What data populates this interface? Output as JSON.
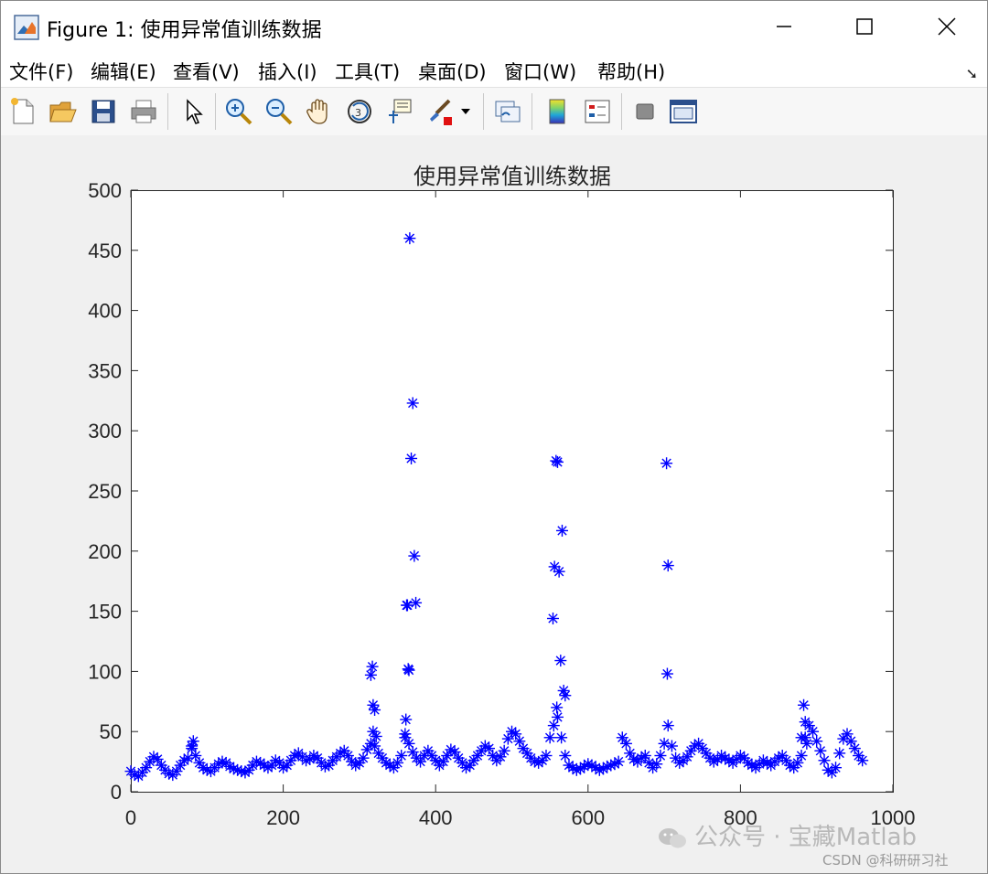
{
  "window": {
    "title": "Figure 1: 使用异常值训练数据",
    "icon": "matlab-figure-icon"
  },
  "menu": {
    "items": [
      "文件(F)",
      "编辑(E)",
      "查看(V)",
      "插入(I)",
      "工具(T)",
      "桌面(D)",
      "窗口(W)",
      "帮助(H)"
    ]
  },
  "toolbar": {
    "icons": [
      "new-figure-icon",
      "open-file-icon",
      "save-icon",
      "print-icon",
      "pointer-icon",
      "zoom-in-icon",
      "zoom-out-icon",
      "pan-hand-icon",
      "rotate-3d-icon",
      "data-cursor-icon",
      "brush-icon",
      "link-plot-icon",
      "colorbar-icon",
      "legend-icon",
      "hide-tools-icon",
      "dock-icon"
    ]
  },
  "watermark": {
    "line1": "公众号 · 宝藏Matlab",
    "line2": "CSDN @科研研习社"
  },
  "colors": {
    "marker": "#0000ff",
    "axes": "#262626",
    "figure_bg": "#f0f0f0"
  },
  "chart_data": {
    "type": "scatter",
    "title": "使用异常值训练数据",
    "marker": "*",
    "xlim": [
      0,
      1000
    ],
    "ylim": [
      0,
      500
    ],
    "xticks": [
      0,
      200,
      400,
      600,
      800,
      1000
    ],
    "yticks": [
      0,
      50,
      100,
      150,
      200,
      250,
      300,
      350,
      400,
      450,
      500
    ],
    "grid": false,
    "series": [
      {
        "x": [
          0,
          5,
          10,
          15,
          20,
          25,
          30,
          35,
          40,
          45,
          50,
          55,
          60,
          65,
          70,
          75,
          80,
          85,
          90,
          95,
          100,
          105,
          110,
          115,
          120,
          125,
          130,
          135,
          140,
          145,
          150,
          155,
          160,
          165,
          170,
          175,
          180,
          185,
          190,
          195,
          200,
          205,
          210,
          215,
          220,
          225,
          230,
          235,
          240,
          245,
          250,
          255,
          260,
          265,
          270,
          275,
          280,
          285,
          290,
          295,
          300,
          305,
          310,
          315,
          320,
          325,
          330,
          335,
          340,
          345,
          350,
          355,
          360,
          365,
          370,
          375,
          380,
          385,
          390,
          395,
          400,
          405,
          410,
          415,
          420,
          425,
          430,
          435,
          440,
          445,
          450,
          455,
          460,
          465,
          470,
          475,
          480,
          485,
          490,
          495,
          500,
          505,
          510,
          515,
          520,
          525,
          530,
          535,
          540,
          545,
          550,
          555,
          560,
          565,
          570,
          575,
          580,
          585,
          590,
          595,
          600,
          605,
          610,
          615,
          620,
          625,
          630,
          635,
          640,
          645,
          650,
          655,
          660,
          665,
          670,
          675,
          680,
          685,
          690,
          695,
          700,
          705,
          710,
          715,
          720,
          725,
          730,
          735,
          740,
          745,
          750,
          755,
          760,
          765,
          770,
          775,
          780,
          785,
          790,
          795,
          800,
          805,
          810,
          815,
          820,
          825,
          830,
          835,
          840,
          845,
          850,
          855,
          860,
          865,
          870,
          875,
          880,
          885,
          890,
          895,
          900,
          905,
          910,
          915,
          920,
          925,
          930,
          935,
          940,
          945,
          950,
          955,
          960,
          315,
          317,
          318,
          320,
          362,
          364,
          366,
          368,
          370,
          372,
          374,
          363,
          365,
          361,
          554,
          556,
          558,
          560,
          562,
          564,
          566,
          568,
          570,
          559,
          703,
          705,
          704,
          883,
          885,
          880,
          887,
          82,
          80,
          318,
          322,
          360
        ],
        "y": [
          17,
          14,
          13,
          16,
          20,
          25,
          29,
          27,
          22,
          18,
          15,
          14,
          17,
          22,
          26,
          28,
          36,
          30,
          24,
          20,
          18,
          17,
          20,
          23,
          25,
          24,
          21,
          19,
          18,
          17,
          16,
          18,
          22,
          25,
          24,
          22,
          20,
          22,
          26,
          24,
          20,
          22,
          26,
          30,
          32,
          29,
          26,
          27,
          30,
          28,
          24,
          21,
          22,
          26,
          29,
          32,
          34,
          30,
          25,
          22,
          24,
          28,
          35,
          40,
          38,
          32,
          28,
          24,
          22,
          20,
          24,
          30,
          45,
          40,
          33,
          28,
          25,
          30,
          34,
          30,
          26,
          22,
          25,
          30,
          35,
          33,
          28,
          24,
          20,
          22,
          26,
          30,
          34,
          38,
          36,
          30,
          26,
          29,
          34,
          44,
          50,
          48,
          42,
          36,
          32,
          28,
          25,
          24,
          26,
          30,
          45,
          55,
          62,
          45,
          30,
          22,
          20,
          18,
          19,
          21,
          23,
          22,
          20,
          18,
          19,
          21,
          22,
          23,
          25,
          45,
          40,
          32,
          27,
          25,
          28,
          30,
          24,
          20,
          23,
          30,
          40,
          55,
          38,
          28,
          24,
          26,
          29,
          34,
          38,
          40,
          36,
          32,
          28,
          25,
          27,
          30,
          28,
          26,
          24,
          27,
          30,
          28,
          24,
          22,
          20,
          23,
          26,
          24,
          22,
          25,
          28,
          30,
          26,
          22,
          20,
          24,
          30,
          45,
          55,
          50,
          42,
          34,
          26,
          18,
          16,
          20,
          32,
          44,
          48,
          42,
          36,
          30,
          26,
          97,
          104,
          72,
          68,
          155,
          102,
          460,
          277,
          323,
          196,
          157,
          155,
          101,
          60,
          144,
          187,
          275,
          274,
          183,
          109,
          217,
          84,
          80,
          70,
          273,
          188,
          98,
          72,
          58,
          45,
          40,
          42,
          38,
          50,
          46,
          48
        ]
      }
    ]
  }
}
